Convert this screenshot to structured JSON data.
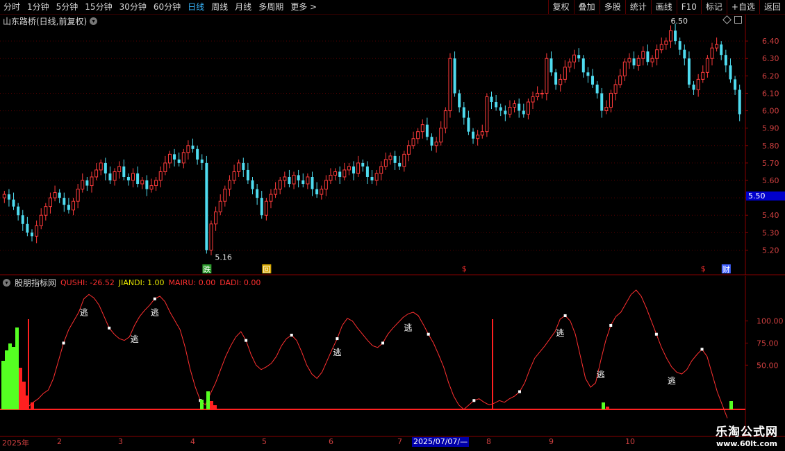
{
  "toolbar": {
    "left": [
      {
        "label": "分时",
        "active": false
      },
      {
        "label": "1分钟",
        "active": false
      },
      {
        "label": "5分钟",
        "active": false
      },
      {
        "label": "15分钟",
        "active": false
      },
      {
        "label": "30分钟",
        "active": false
      },
      {
        "label": "60分钟",
        "active": false
      },
      {
        "label": "日线",
        "active": true
      },
      {
        "label": "周线",
        "active": false
      },
      {
        "label": "月线",
        "active": false
      },
      {
        "label": "多周期",
        "active": false
      },
      {
        "label": "更多 >",
        "active": false
      }
    ],
    "right": [
      "复权",
      "叠加",
      "多股",
      "统计",
      "画线",
      "F10",
      "标记",
      "+自选",
      "返回"
    ]
  },
  "stock": {
    "title": "山东路桥(日线,前复权)"
  },
  "price_axis": {
    "labels": [
      "6.40",
      "6.30",
      "6.20",
      "6.10",
      "6.00",
      "5.90",
      "5.80",
      "5.70",
      "5.60",
      "5.50",
      "5.40",
      "5.30",
      "5.20"
    ]
  },
  "current_price": "5.50",
  "annotations": {
    "high": "6.50",
    "low": "5.16",
    "markers": [
      {
        "text": "跌",
        "color": "#2a9a2a",
        "idx": 44
      },
      {
        "text": "回",
        "color": "#d8a800",
        "idx": 57
      },
      {
        "text": "$",
        "color": "#ff3030",
        "idx": 100
      },
      {
        "text": "$",
        "color": "#ff3030",
        "idx": 152
      },
      {
        "text": "财",
        "color": "#4060ff",
        "idx": 157
      }
    ]
  },
  "indicator": {
    "name": "股朋指标网",
    "values": [
      {
        "label": "QUSHI: -26.52",
        "color": "#ff3030"
      },
      {
        "label": "JIANDI: 1.00",
        "color": "#e8e800"
      },
      {
        "label": "MAIRU: 0.00",
        "color": "#ff3030"
      },
      {
        "label": "DADI: 0.00",
        "color": "#ff3030"
      }
    ],
    "axis_labels": [
      "100.00",
      "75.00",
      "50.00"
    ],
    "escape_label": "逃"
  },
  "x_axis": {
    "labels": [
      {
        "text": "2025年",
        "x": 3
      },
      {
        "text": "2",
        "x": 82
      },
      {
        "text": "3",
        "x": 170
      },
      {
        "text": "4",
        "x": 274
      },
      {
        "text": "5",
        "x": 377
      },
      {
        "text": "6",
        "x": 473
      },
      {
        "text": "7",
        "x": 572
      },
      {
        "text": "8",
        "x": 700
      },
      {
        "text": "9",
        "x": 790
      },
      {
        "text": "10",
        "x": 900
      }
    ],
    "cursor": "2025/07/07/—"
  },
  "watermark": {
    "title": "乐淘公式网",
    "url": "www.60lt.com"
  },
  "chart_data": {
    "type": "candlestick",
    "y_range": [
      5.15,
      6.52
    ],
    "closes": [
      5.52,
      5.49,
      5.45,
      5.4,
      5.35,
      5.3,
      5.28,
      5.34,
      5.4,
      5.45,
      5.5,
      5.53,
      5.5,
      5.46,
      5.43,
      5.48,
      5.55,
      5.6,
      5.57,
      5.62,
      5.66,
      5.7,
      5.64,
      5.6,
      5.65,
      5.68,
      5.62,
      5.6,
      5.64,
      5.58,
      5.6,
      5.55,
      5.57,
      5.6,
      5.65,
      5.7,
      5.75,
      5.72,
      5.7,
      5.76,
      5.8,
      5.78,
      5.72,
      5.7,
      5.2,
      5.35,
      5.42,
      5.48,
      5.55,
      5.6,
      5.65,
      5.7,
      5.66,
      5.6,
      5.55,
      5.5,
      5.4,
      5.48,
      5.52,
      5.55,
      5.6,
      5.62,
      5.58,
      5.63,
      5.6,
      5.58,
      5.62,
      5.55,
      5.52,
      5.55,
      5.6,
      5.63,
      5.65,
      5.62,
      5.66,
      5.68,
      5.64,
      5.7,
      5.68,
      5.62,
      5.6,
      5.64,
      5.68,
      5.72,
      5.74,
      5.7,
      5.68,
      5.75,
      5.8,
      5.84,
      5.88,
      5.92,
      5.85,
      5.8,
      5.82,
      5.9,
      6.0,
      6.3,
      6.1,
      6.02,
      5.96,
      5.88,
      5.84,
      5.86,
      5.88,
      6.08,
      6.05,
      6.02,
      6.0,
      5.98,
      6.02,
      6.04,
      6.0,
      5.98,
      6.05,
      6.08,
      6.1,
      6.1,
      6.3,
      6.22,
      6.15,
      6.18,
      6.25,
      6.28,
      6.32,
      6.3,
      6.22,
      6.2,
      6.15,
      6.1,
      6.0,
      6.02,
      6.1,
      6.15,
      6.2,
      6.28,
      6.3,
      6.26,
      6.3,
      6.34,
      6.28,
      6.3,
      6.35,
      6.38,
      6.4,
      6.46,
      6.4,
      6.35,
      6.3,
      6.15,
      6.12,
      6.18,
      6.22,
      6.3,
      6.36,
      6.38,
      6.32,
      6.26,
      6.18,
      6.12,
      5.98
    ],
    "indicator_line": [
      10,
      8,
      5,
      2,
      1,
      3,
      8,
      12,
      18,
      22,
      35,
      55,
      75,
      90,
      100,
      110,
      125,
      130,
      126,
      118,
      105,
      92,
      85,
      80,
      78,
      82,
      95,
      105,
      112,
      118,
      125,
      128,
      122,
      110,
      100,
      90,
      70,
      45,
      25,
      10,
      5,
      18,
      30,
      45,
      60,
      72,
      82,
      88,
      78,
      62,
      50,
      45,
      48,
      52,
      60,
      72,
      80,
      84,
      78,
      65,
      50,
      40,
      35,
      42,
      55,
      68,
      80,
      95,
      103,
      100,
      92,
      85,
      78,
      72,
      70,
      75,
      85,
      92,
      98,
      104,
      108,
      110,
      106,
      96,
      85,
      75,
      62,
      48,
      30,
      15,
      5,
      0,
      5,
      10,
      12,
      8,
      5,
      7,
      10,
      8,
      12,
      15,
      20,
      30,
      45,
      58,
      65,
      72,
      80,
      88,
      102,
      106,
      100,
      85,
      60,
      35,
      25,
      30,
      55,
      78,
      95,
      105,
      110,
      120,
      130,
      135,
      128,
      115,
      100,
      85,
      70,
      58,
      48,
      42,
      40,
      45,
      55,
      62,
      68,
      60,
      40,
      20,
      5,
      -10
    ]
  }
}
